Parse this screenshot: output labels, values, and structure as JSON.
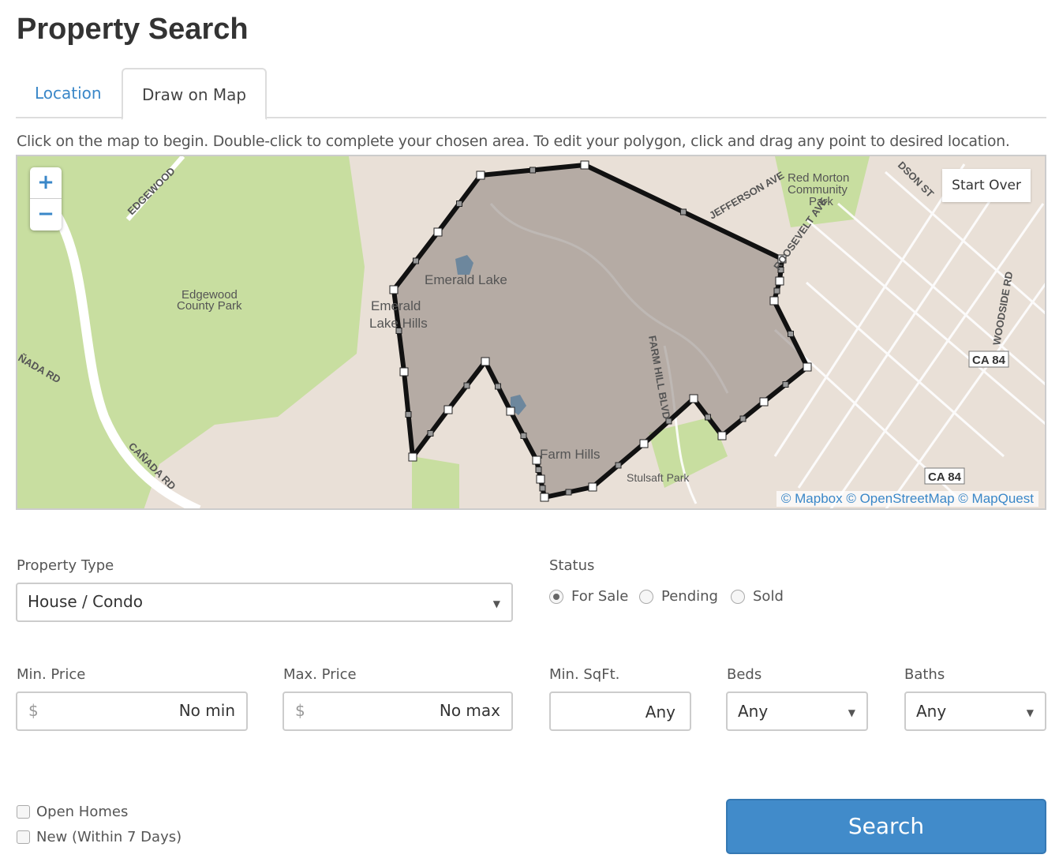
{
  "page_title": "Property Search",
  "tabs": [
    {
      "label": "Location",
      "active": false
    },
    {
      "label": "Draw on Map",
      "active": true
    }
  ],
  "instructions": "Click on the map to begin. Double-click to complete your chosen area. To edit your polygon, click and drag any point to desired location.",
  "map": {
    "zoom_in": "+",
    "zoom_out": "−",
    "start_over": "Start Over",
    "attribution": "© Mapbox © OpenStreetMap © MapQuest",
    "labels": {
      "edgewood_rd": "EDGEWOOD",
      "edgewood_park_1": "Edgewood",
      "edgewood_park_2": "County Park",
      "emerald_lake": "Emerald Lake",
      "emerald_hills_1": "Emerald",
      "emerald_hills_2": "Lake Hills",
      "farm_hills": "Farm Hills",
      "farm_hill_blvd": "FARM HILL BLVD",
      "stulsaft": "Stulsaft Park",
      "jefferson": "JEFFERSON AVE",
      "roosevelt": "ROOSEVELT AVE",
      "red_morton_1": "Red Morton",
      "red_morton_2": "Community",
      "red_morton_3": "Park",
      "ca84_1": "CA 84",
      "ca84_2": "CA 84",
      "woodside": "WOODSIDE RD",
      "canada_1": "CAÑADA RD",
      "canada_2": "ÑADA RD",
      "hudson": "DSON ST"
    },
    "colors": {
      "land": "#e9e0d7",
      "park": "#c8dea0",
      "polygon_fill": "#8a807a",
      "water": "#4a90c8"
    }
  },
  "form": {
    "property_type": {
      "label": "Property Type",
      "value": "House / Condo"
    },
    "status": {
      "label": "Status",
      "options": [
        {
          "label": "For Sale",
          "checked": true
        },
        {
          "label": "Pending",
          "checked": false
        },
        {
          "label": "Sold",
          "checked": false
        }
      ]
    },
    "min_price": {
      "label": "Min. Price",
      "prefix": "$",
      "placeholder": "No min"
    },
    "max_price": {
      "label": "Max. Price",
      "prefix": "$",
      "placeholder": "No max"
    },
    "min_sqft": {
      "label": "Min. SqFt.",
      "placeholder": "Any"
    },
    "beds": {
      "label": "Beds",
      "value": "Any"
    },
    "baths": {
      "label": "Baths",
      "value": "Any"
    },
    "open_homes": {
      "label": "Open Homes",
      "checked": false
    },
    "new_listings": {
      "label": "New (Within 7 Days)",
      "checked": false
    },
    "search": "Search"
  }
}
